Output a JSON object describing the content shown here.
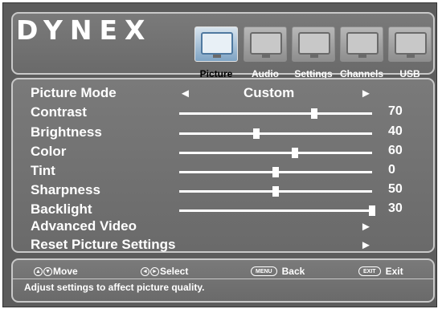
{
  "brand": "DYNEX",
  "tabs": [
    {
      "label": "Picture",
      "icon": "picture-icon",
      "active": true
    },
    {
      "label": "Audio",
      "icon": "audio-icon",
      "active": false
    },
    {
      "label": "Settings",
      "icon": "settings-icon",
      "active": false
    },
    {
      "label": "Channels",
      "icon": "channels-icon",
      "active": false
    },
    {
      "label": "USB",
      "icon": "usb-icon",
      "active": false
    }
  ],
  "picture_mode": {
    "label": "Picture Mode",
    "value": "Custom",
    "left_arrow": "◄",
    "right_arrow": "►"
  },
  "sliders": [
    {
      "label": "Contrast",
      "value": "70",
      "level": 0.7
    },
    {
      "label": "Brightness",
      "value": "40",
      "level": 0.4
    },
    {
      "label": "Color",
      "value": "60",
      "level": 0.6
    },
    {
      "label": "Tint",
      "value": "0",
      "level": 0.5
    },
    {
      "label": "Sharpness",
      "value": "50",
      "level": 0.5
    },
    {
      "label": "Backlight",
      "value": "30",
      "level": 1.0
    }
  ],
  "submenus": [
    {
      "label": "Advanced Video",
      "arrow": "►"
    },
    {
      "label": "Reset Picture Settings",
      "arrow": "►"
    }
  ],
  "footer": {
    "move": "Move",
    "select": "Select",
    "menu_key": "MENU",
    "back": "Back",
    "exit_key": "EXIT",
    "exit": "Exit",
    "help": "Adjust settings to affect picture quality."
  }
}
